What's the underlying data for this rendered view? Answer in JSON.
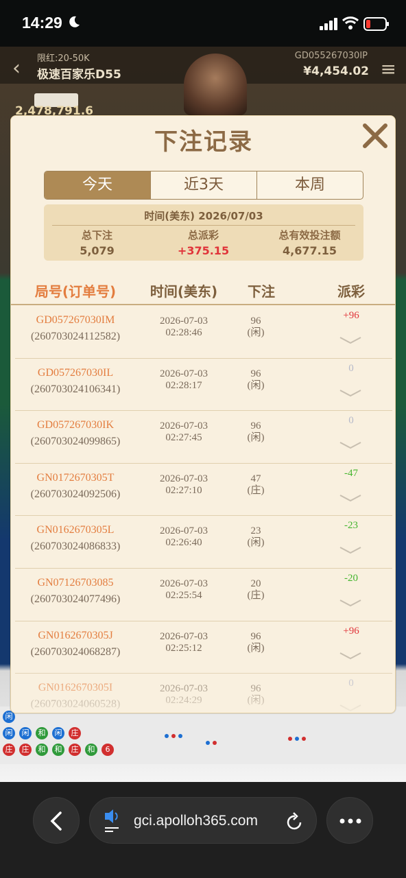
{
  "status_bar": {
    "time": "14:29"
  },
  "background_game": {
    "limit": "限红:20-50K",
    "table_name": "极速百家乐D55",
    "account_id": "GD055267030IP",
    "balance": "¥4,454.02",
    "pool": "2,478,791.6"
  },
  "modal": {
    "title": "下注记录",
    "tabs": [
      {
        "label": "今天",
        "active": true
      },
      {
        "label": "近3天",
        "active": false
      },
      {
        "label": "本周",
        "active": false
      }
    ],
    "summary": {
      "time_line": "时间(美东)  2026/07/03",
      "total_bet_label": "总下注",
      "total_bet": "5,079",
      "total_payout_label": "总派彩",
      "total_payout": "+375.15",
      "total_valid_label": "总有效投注额",
      "total_valid": "4,677.15"
    },
    "headers": {
      "id": "局号(订单号)",
      "time": "时间(美东)",
      "bet": "下注",
      "payout": "派彩"
    },
    "records": [
      {
        "game_id": "GD057267030IM",
        "order": "(260703024112582)",
        "date": "2026-07-03",
        "time": "02:28:46",
        "amount": "96",
        "side": "(闲)",
        "payout": "+96",
        "result": "win"
      },
      {
        "game_id": "GD057267030IL",
        "order": "(260703024106341)",
        "date": "2026-07-03",
        "time": "02:28:17",
        "amount": "96",
        "side": "(闲)",
        "payout": "0",
        "result": "zero"
      },
      {
        "game_id": "GD057267030IK",
        "order": "(260703024099865)",
        "date": "2026-07-03",
        "time": "02:27:45",
        "amount": "96",
        "side": "(闲)",
        "payout": "0",
        "result": "zero"
      },
      {
        "game_id": "GN0172670305T",
        "order": "(260703024092506)",
        "date": "2026-07-03",
        "time": "02:27:10",
        "amount": "47",
        "side": "(庄)",
        "payout": "-47",
        "result": "loss"
      },
      {
        "game_id": "GN0162670305L",
        "order": "(260703024086833)",
        "date": "2026-07-03",
        "time": "02:26:40",
        "amount": "23",
        "side": "(闲)",
        "payout": "-23",
        "result": "loss"
      },
      {
        "game_id": "GN07126703085",
        "order": "(260703024077496)",
        "date": "2026-07-03",
        "time": "02:25:54",
        "amount": "20",
        "side": "(庄)",
        "payout": "-20",
        "result": "loss"
      },
      {
        "game_id": "GN0162670305J",
        "order": "(260703024068287)",
        "date": "2026-07-03",
        "time": "02:25:12",
        "amount": "96",
        "side": "(闲)",
        "payout": "+96",
        "result": "win"
      },
      {
        "game_id": "GN0162670305I",
        "order": "(260703024060528)",
        "date": "2026-07-03",
        "time": "02:24:29",
        "amount": "96",
        "side": "(闲)",
        "payout": "0",
        "result": "zero"
      }
    ]
  },
  "browser": {
    "url": "gci.apolloh365.com"
  },
  "colors": {
    "accent": "#ae8a55",
    "win": "#e0343a",
    "loss": "#44b52e",
    "id_orange": "#e37d3f"
  }
}
